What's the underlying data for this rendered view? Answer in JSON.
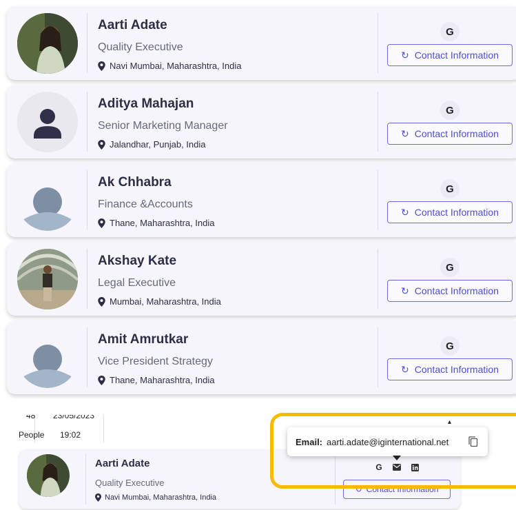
{
  "contacts": [
    {
      "name": "Aarti Adate",
      "title": "Quality Executive",
      "location": "Navi Mumbai, Maharashtra, India",
      "avatar": "photo-woman",
      "source_icon": "G",
      "button_label": "Contact Information"
    },
    {
      "name": "Aditya Mahajan",
      "title": "Senior Marketing Manager",
      "location": "Jalandhar, Punjab, India",
      "avatar": "default-person-dark",
      "source_icon": "G",
      "button_label": "Contact Information"
    },
    {
      "name": "Ak Chhabra",
      "title": "Finance &Accounts",
      "location": "Thane, Maharashtra, India",
      "avatar": "default-person-blue",
      "source_icon": "G",
      "button_label": "Contact Information"
    },
    {
      "name": "Akshay Kate",
      "title": "Legal Executive",
      "location": "Mumbai, Maharashtra, India",
      "avatar": "photo-man",
      "source_icon": "G",
      "button_label": "Contact Information"
    },
    {
      "name": "Amit Amrutkar",
      "title": "Vice President Strategy",
      "location": "Thane, Maharashtra, India",
      "avatar": "default-person-blue",
      "source_icon": "G",
      "button_label": "Contact Information"
    }
  ],
  "stats": {
    "people_count": "48",
    "people_label": "People",
    "date": "23/05/2023",
    "time": "19:02"
  },
  "mini_card": {
    "name": "Aarti Adate",
    "title": "Quality Executive",
    "location": "Navi Mumbai, Maharashtra, India",
    "button_label": "Contact Information"
  },
  "email_popup": {
    "label": "Email:",
    "value": "aarti.adate@iginternational.net"
  },
  "colors": {
    "accent": "#4f4bd8",
    "highlight": "#f5bb00",
    "card_bg": "#f6f5fb"
  }
}
